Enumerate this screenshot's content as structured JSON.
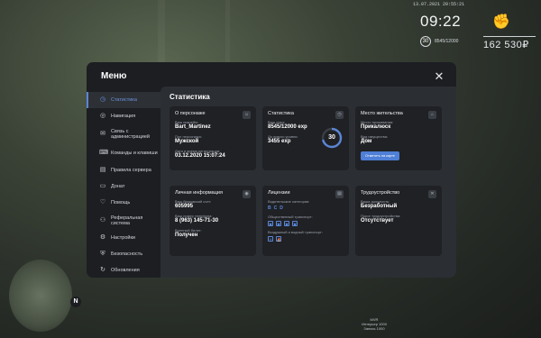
{
  "hud": {
    "date": "13.07.2021 20:55:21",
    "time": "09:22",
    "level": "30",
    "exp": "8545/12000",
    "money": "162 530₽"
  },
  "map": {
    "compass": "N"
  },
  "footer": {
    "line1": "MVR",
    "line2": "Интерьер 1000",
    "line3": "Запись 1000"
  },
  "modal": {
    "title": "Меню",
    "close_icon": "close-icon"
  },
  "sidebar": {
    "items": [
      {
        "label": "Статистика",
        "icon": "clock-icon",
        "active": true
      },
      {
        "label": "Навигация",
        "icon": "compass-icon"
      },
      {
        "label": "Связь с администрацией",
        "icon": "chat-icon"
      },
      {
        "label": "Команды и клавиши",
        "icon": "keyboard-icon"
      },
      {
        "label": "Правила сервера",
        "icon": "book-icon"
      },
      {
        "label": "Донат",
        "icon": "wallet-icon"
      },
      {
        "label": "Помощь",
        "icon": "heart-icon"
      },
      {
        "label": "Реферальная система",
        "icon": "users-icon"
      },
      {
        "label": "Настройки",
        "icon": "gear-icon"
      },
      {
        "label": "Безопасность",
        "icon": "shield-icon"
      },
      {
        "label": "Обновления",
        "icon": "refresh-icon"
      }
    ]
  },
  "content": {
    "title": "Статистика",
    "about": {
      "title": "О персонаже",
      "nick_label": "Ваш никнейм:",
      "nick": "Bart_Martinez",
      "sex_label": "Пол персонажа:",
      "sex": "Мужской",
      "reg_label": "Дата и время регистрации:",
      "reg": "03.12.2020 15:07:24"
    },
    "stats": {
      "title": "Статистика",
      "exp_label": "Ваш опыт:",
      "exp": "8545/12000 exp",
      "next_label": "До нового уровня:",
      "next": "3455 exp",
      "level": "30",
      "progress": 0.712
    },
    "residence": {
      "title": "Место жительства",
      "place_label": "Место проживания:",
      "place": "Прикалюск",
      "type_label": "Вид имущества:",
      "type": "Дом",
      "button": "Отметить на карте"
    },
    "personal": {
      "title": "Личная информация",
      "bank_label": "Ваш банковский счет:",
      "bank": "605995",
      "phone_label": "Ваш номер телефона:",
      "phone": "8 (963) 145-71-30",
      "military_label": "Военный билет:",
      "military": "Получен"
    },
    "licenses": {
      "title": "Лицензии",
      "drive_label": "Водительские категории:",
      "drive": [
        "B",
        "C",
        "D"
      ],
      "public_label": "Общественный транспорт:",
      "air_label": "Воздушный и водный транспорт:"
    },
    "job": {
      "title": "Трудоустройство",
      "position_label": "Ваша должность:",
      "position": "Безработный",
      "tenure_label": "Порог трудоустройства:",
      "tenure": "Отсутствует"
    }
  }
}
